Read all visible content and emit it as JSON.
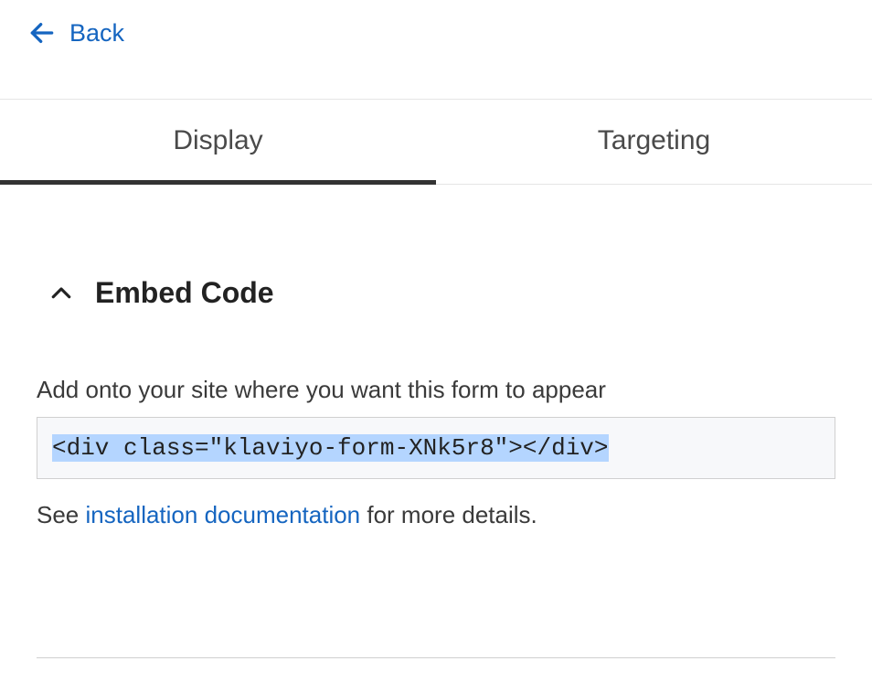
{
  "nav": {
    "back_label": "Back"
  },
  "tabs": {
    "display": "Display",
    "targeting": "Targeting"
  },
  "section": {
    "title": "Embed Code",
    "instruction": "Add onto your site where you want this form to appear",
    "code": "<div class=\"klaviyo-form-XNk5r8\"></div>",
    "helper_prefix": "See ",
    "doc_link": "installation documentation",
    "helper_suffix": " for more details."
  }
}
